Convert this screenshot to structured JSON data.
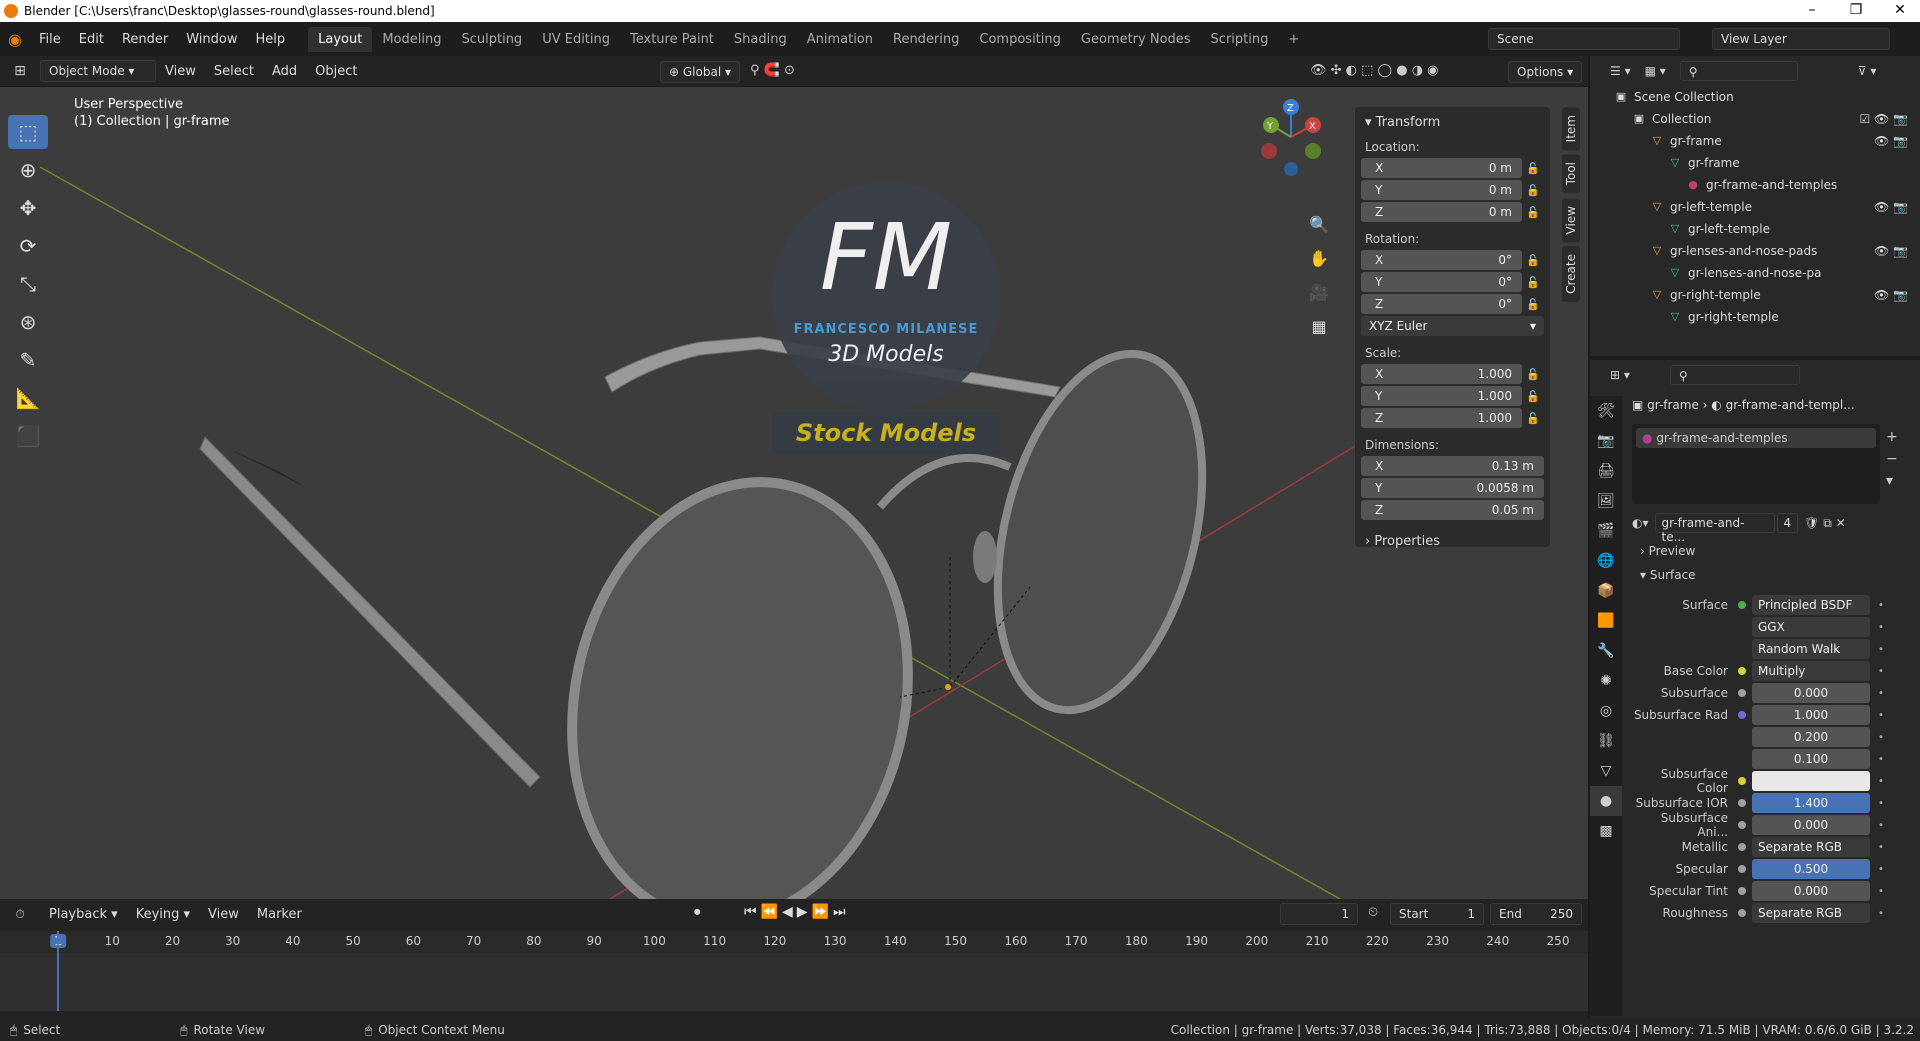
{
  "window": {
    "title": "Blender [C:\\Users\\franc\\Desktop\\glasses-round\\glasses-round.blend]",
    "minimize": "–",
    "maximize": "❐",
    "close": "✕"
  },
  "menu": [
    "File",
    "Edit",
    "Render",
    "Window",
    "Help"
  ],
  "workspaces": [
    "Layout",
    "Modeling",
    "Sculpting",
    "UV Editing",
    "Texture Paint",
    "Shading",
    "Animation",
    "Rendering",
    "Compositing",
    "Geometry Nodes",
    "Scripting"
  ],
  "workspace_add": "+",
  "scene": {
    "name": "Scene",
    "view_layer": "View Layer"
  },
  "header3d": {
    "mode": "Object Mode",
    "view": "View",
    "select": "Select",
    "add": "Add",
    "object": "Object",
    "orientation": "Global",
    "options": "Options"
  },
  "viewport": {
    "perspective": "User Perspective",
    "collection_info": "(1) Collection | gr-frame"
  },
  "watermark": {
    "initials": "FM",
    "name": "FRANCESCO MILANESE",
    "sub": "3D Models",
    "banner": "Stock Models"
  },
  "gizmo": {
    "x": "X",
    "y": "Y",
    "z": "Z"
  },
  "npanel": {
    "transform": "Transform",
    "location_label": "Location:",
    "location": [
      {
        "axis": "X",
        "value": "0 m"
      },
      {
        "axis": "Y",
        "value": "0 m"
      },
      {
        "axis": "Z",
        "value": "0 m"
      }
    ],
    "rotation_label": "Rotation:",
    "rotation": [
      {
        "axis": "X",
        "value": "0°"
      },
      {
        "axis": "Y",
        "value": "0°"
      },
      {
        "axis": "Z",
        "value": "0°"
      }
    ],
    "rotation_mode": "XYZ Euler",
    "scale_label": "Scale:",
    "scale": [
      {
        "axis": "X",
        "value": "1.000"
      },
      {
        "axis": "Y",
        "value": "1.000"
      },
      {
        "axis": "Z",
        "value": "1.000"
      }
    ],
    "dimensions_label": "Dimensions:",
    "dimensions": [
      {
        "axis": "X",
        "value": "0.13 m"
      },
      {
        "axis": "Y",
        "value": "0.0058 m"
      },
      {
        "axis": "Z",
        "value": "0.05 m"
      }
    ],
    "properties": "Properties",
    "tabs": [
      "Item",
      "Tool",
      "View",
      "Create"
    ]
  },
  "timeline": {
    "playback": "Playback",
    "keying": "Keying",
    "view": "View",
    "marker": "Marker",
    "current_frame": "1",
    "start_label": "Start",
    "start": "1",
    "end_label": "End",
    "end": "250",
    "ticks": [
      "1",
      "10",
      "20",
      "30",
      "40",
      "50",
      "60",
      "70",
      "80",
      "90",
      "100",
      "110",
      "120",
      "130",
      "140",
      "150",
      "160",
      "170",
      "180",
      "190",
      "200",
      "210",
      "220",
      "230",
      "240",
      "250"
    ]
  },
  "status": {
    "select": "Select",
    "rotate": "Rotate View",
    "context": "Object Context Menu",
    "stats": "Collection | gr-frame | Verts:37,038 | Faces:36,944 | Tris:73,888 | Objects:0/4 | Memory: 71.5 MiB | VRAM: 0.6/6.0 GiB | 3.2.2"
  },
  "outliner": {
    "items": [
      {
        "label": "Scene Collection",
        "indent": 0,
        "icon": "scene-collection-icon",
        "vis": ""
      },
      {
        "label": "Collection",
        "indent": 1,
        "icon": "collection-icon",
        "vis": "☑ 👁 📷"
      },
      {
        "label": "gr-frame",
        "indent": 2,
        "icon": "object-icon",
        "vis": "👁 📷"
      },
      {
        "label": "gr-frame",
        "indent": 3,
        "icon": "mesh-icon",
        "vis": ""
      },
      {
        "label": "gr-frame-and-temples",
        "indent": 4,
        "icon": "material-icon",
        "vis": ""
      },
      {
        "label": "gr-left-temple",
        "indent": 2,
        "icon": "object-icon",
        "vis": "👁 📷"
      },
      {
        "label": "gr-left-temple",
        "indent": 3,
        "icon": "mesh-icon",
        "vis": ""
      },
      {
        "label": "gr-lenses-and-nose-pads",
        "indent": 2,
        "icon": "object-icon",
        "vis": "👁 📷"
      },
      {
        "label": "gr-lenses-and-nose-pa",
        "indent": 3,
        "icon": "mesh-icon",
        "vis": ""
      },
      {
        "label": "gr-right-temple",
        "indent": 2,
        "icon": "object-icon",
        "vis": "👁 📷"
      },
      {
        "label": "gr-right-temple",
        "indent": 3,
        "icon": "mesh-icon",
        "vis": ""
      }
    ]
  },
  "properties": {
    "breadcrumb_object": "gr-frame",
    "breadcrumb_material": "gr-frame-and-templ...",
    "slot": "gr-frame-and-temples",
    "material_name": "gr-frame-and-te...",
    "users": "4",
    "preview": "Preview",
    "surface_section": "Surface",
    "rows": [
      {
        "label": "Surface",
        "value": "Principled BSDF",
        "dot": "#4cae4c"
      },
      {
        "label": "",
        "value": "GGX",
        "dot": ""
      },
      {
        "label": "",
        "value": "Random Walk",
        "dot": ""
      },
      {
        "label": "Base Color",
        "value": "Multiply",
        "dot": "#d6d038"
      },
      {
        "label": "Subsurface",
        "value": "0.000",
        "dot": "#a0a0a0"
      },
      {
        "label": "Subsurface Rad",
        "value": "1.000",
        "dot": "#6d6ddb"
      },
      {
        "label": "",
        "value": "0.200",
        "dot": ""
      },
      {
        "label": "",
        "value": "0.100",
        "dot": ""
      },
      {
        "label": "Subsurface Color",
        "value": "",
        "dot": "#d6d038"
      },
      {
        "label": "Subsurface IOR",
        "value": "1.400",
        "dot": "#a0a0a0"
      },
      {
        "label": "Subsurface Ani...",
        "value": "0.000",
        "dot": "#a0a0a0"
      },
      {
        "label": "Metallic",
        "value": "Separate RGB",
        "dot": "#a0a0a0"
      },
      {
        "label": "Specular",
        "value": "0.500",
        "dot": "#a0a0a0"
      },
      {
        "label": "Specular Tint",
        "value": "0.000",
        "dot": "#a0a0a0"
      },
      {
        "label": "Roughness",
        "value": "Separate RGB",
        "dot": "#a0a0a0"
      }
    ]
  },
  "colors": {
    "accent": "#4772b3",
    "frame": "#4772b3"
  }
}
